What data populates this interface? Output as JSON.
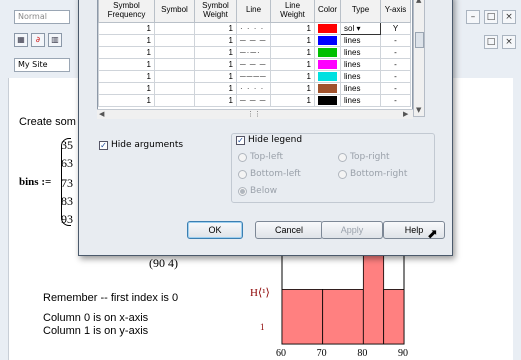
{
  "app": {
    "style_combo": "Normal",
    "site_combo": "My Site",
    "toolbar_icons": [
      "grid-icon",
      "formula-icon",
      "table-icon"
    ]
  },
  "worksheet": {
    "create_text": "Create som",
    "bins_label": "bins :=",
    "matrix_rows": [
      "35",
      "63",
      "73",
      "83",
      "93"
    ],
    "bottom_row": "(90   4)",
    "remember_text": "Remember -- first index is 0",
    "col0_text": "Column 0 is on x-axis",
    "col1_text": "Column 1 is on y-axis",
    "y_axis_label": "H⟨¹⟩",
    "y_axis_sub": "1",
    "x_ticks": [
      "60",
      "70",
      "80",
      "90"
    ]
  },
  "chart_data": {
    "type": "bar",
    "categories": [
      "60-70",
      "70-80",
      "80-85",
      "85-90"
    ],
    "values": [
      3,
      3,
      5,
      3
    ],
    "xlim": [
      60,
      90
    ],
    "xticks": [
      60,
      70,
      80,
      90
    ],
    "bar_color": "#ff8080"
  },
  "dialog": {
    "columns": [
      "Symbol Frequency",
      "Symbol",
      "Symbol Weight",
      "Line",
      "Line Weight",
      "Color",
      "Type",
      "Y-axis"
    ],
    "rows": [
      {
        "freq": "1",
        "symbol": "",
        "sweight": "1",
        "line": "· · · ·",
        "lweight": "1",
        "color": "#ff0000",
        "type": "sol",
        "yaxis": "Y"
      },
      {
        "freq": "1",
        "symbol": "",
        "sweight": "1",
        "line": "─ ─ ─",
        "lweight": "1",
        "color": "#0000ff",
        "type": "lines",
        "yaxis": "-"
      },
      {
        "freq": "1",
        "symbol": "",
        "sweight": "1",
        "line": "─·─·",
        "lweight": "1",
        "color": "#00c000",
        "type": "lines",
        "yaxis": "-"
      },
      {
        "freq": "1",
        "symbol": "",
        "sweight": "1",
        "line": "─ ─ ─",
        "lweight": "1",
        "color": "#ff00ff",
        "type": "lines",
        "yaxis": "-"
      },
      {
        "freq": "1",
        "symbol": "",
        "sweight": "1",
        "line": "────",
        "lweight": "1",
        "color": "#00e0e0",
        "type": "lines",
        "yaxis": "-"
      },
      {
        "freq": "1",
        "symbol": "",
        "sweight": "1",
        "line": "· · · ·",
        "lweight": "1",
        "color": "#a0522d",
        "type": "lines",
        "yaxis": "-"
      },
      {
        "freq": "1",
        "symbol": "",
        "sweight": "1",
        "line": "─ ─ ─",
        "lweight": "1",
        "color": "#000000",
        "type": "lines",
        "yaxis": "-"
      }
    ],
    "hide_arguments": "Hide arguments",
    "hide_legend": "Hide legend",
    "positions": {
      "top_left": "Top-left",
      "top_right": "Top-right",
      "bottom_left": "Bottom-left",
      "bottom_right": "Bottom-right",
      "below": "Below"
    },
    "buttons": {
      "ok": "OK",
      "cancel": "Cancel",
      "apply": "Apply",
      "help": "Help"
    }
  }
}
